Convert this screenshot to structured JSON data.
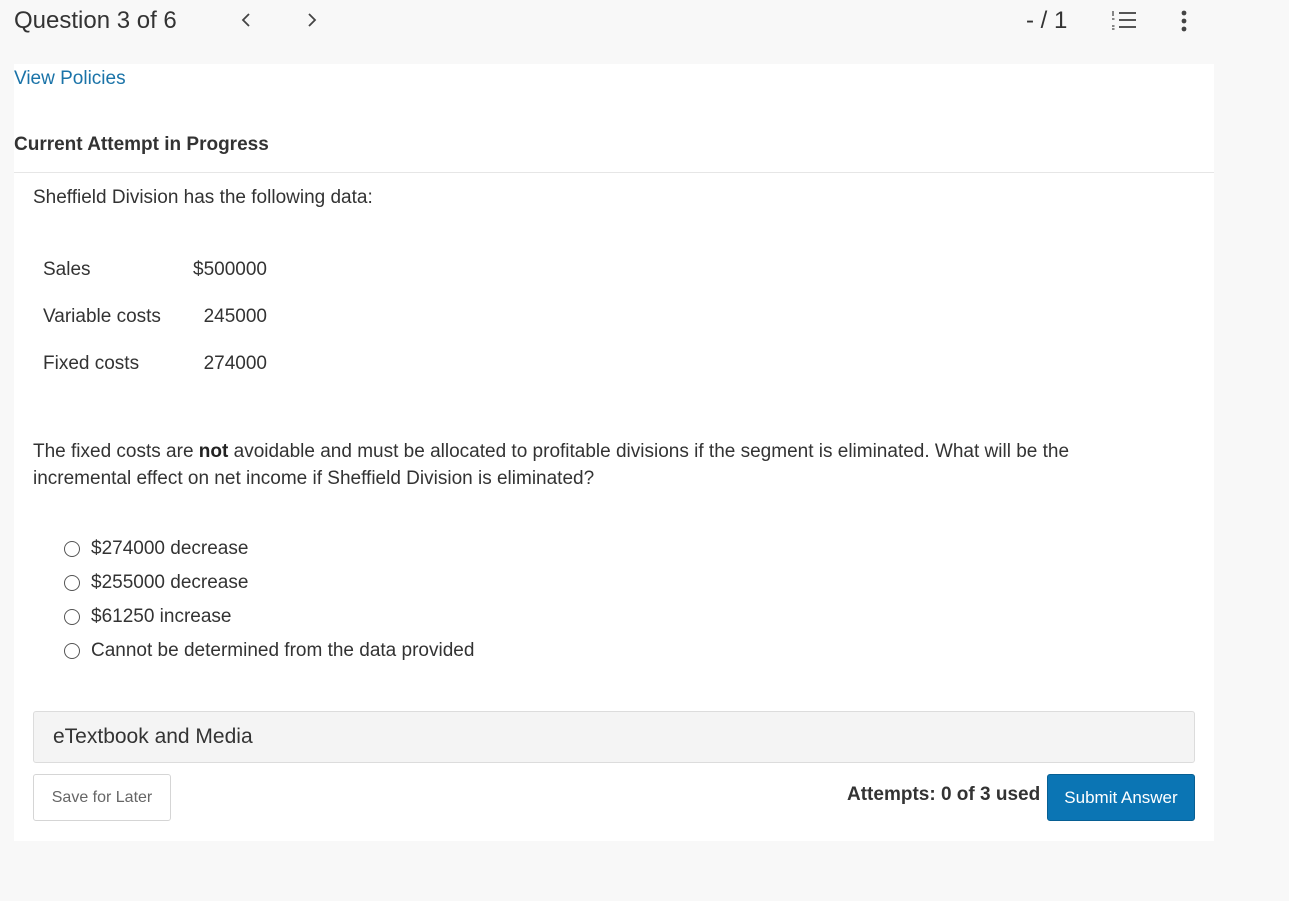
{
  "header": {
    "question_title": "Question 3 of 6",
    "score": "- / 1",
    "prev_icon": "chevron-left-icon",
    "next_icon": "chevron-right-icon",
    "list_icon": "numbered-list-icon",
    "more_icon": "vertical-ellipsis-icon"
  },
  "links": {
    "view_policies": "View Policies"
  },
  "attempt": {
    "heading": "Current Attempt in Progress"
  },
  "problem": {
    "intro": "Sheffield Division has the following data:",
    "rows": [
      {
        "label": "Sales",
        "value": "$500000"
      },
      {
        "label": "Variable costs",
        "value": "245000"
      },
      {
        "label": "Fixed costs",
        "value": "274000"
      }
    ],
    "question_pre": "The fixed costs are ",
    "question_bold": "not",
    "question_post": " avoidable and must be allocated to profitable divisions if the segment is eliminated. What will be the incremental effect on net income if Sheffield Division is eliminated?"
  },
  "options": [
    "$274000 decrease",
    "$255000 decrease",
    "$61250 increase",
    "Cannot be determined from the data provided"
  ],
  "etextbook": {
    "label": "eTextbook and Media"
  },
  "footer": {
    "save_label": "Save for Later",
    "attempts_text": "Attempts: 0 of 3 used",
    "submit_label": "Submit Answer"
  },
  "colors": {
    "link": "#1a73a8",
    "primary_button": "#0b75b4"
  }
}
